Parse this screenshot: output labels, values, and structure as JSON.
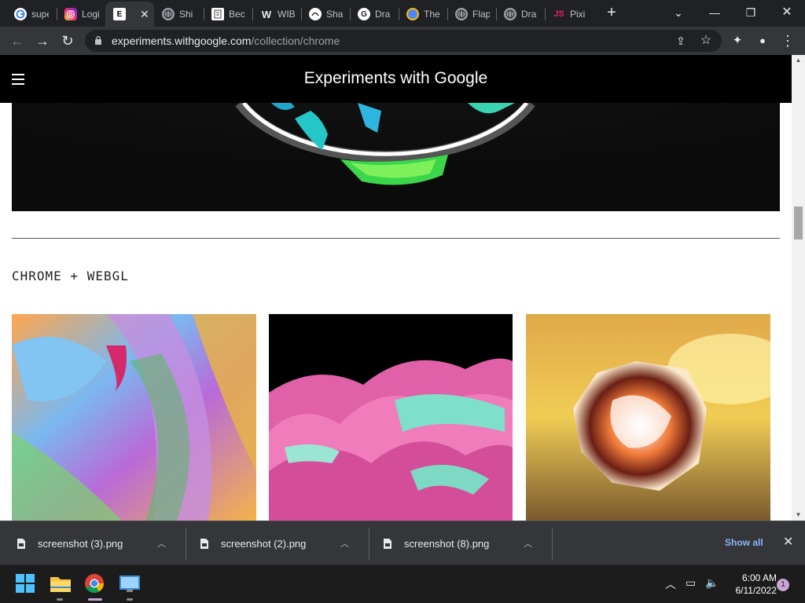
{
  "tabs": [
    {
      "label": "supe",
      "icon": "google-icon",
      "color": "#ffffff"
    },
    {
      "label": "Logi",
      "icon": "instagram-icon",
      "color": "#e1306c"
    },
    {
      "label": "",
      "icon": "experiments-icon",
      "color": "#ffffff",
      "active": true
    },
    {
      "label": "Shi",
      "icon": "globe-icon",
      "color": "#9aa0a6"
    },
    {
      "label": "Bec",
      "icon": "doc-icon",
      "color": "#ffffff"
    },
    {
      "label": "WIB",
      "icon": "w-icon",
      "color": "#ffffff"
    },
    {
      "label": "Sha",
      "icon": "shader-icon",
      "color": "#ffffff"
    },
    {
      "label": "Dra",
      "icon": "github-icon",
      "color": "#ffffff"
    },
    {
      "label": "The",
      "icon": "chrome-logo-icon",
      "color": "#4f86f7"
    },
    {
      "label": "Flap",
      "icon": "globe-icon",
      "color": "#9aa0a6"
    },
    {
      "label": "Dra",
      "icon": "globe-icon",
      "color": "#9aa0a6"
    },
    {
      "label": "Pixi",
      "icon": "js-icon",
      "color": "#e91e63"
    }
  ],
  "active_tab_letter": "E",
  "active_tab_close": "✕",
  "github_letter": "G",
  "js_letter": "JS",
  "w_letter": "W",
  "new_tab": "+",
  "window": {
    "tab_search": "⌄",
    "minimize": "—",
    "restore": "❐",
    "close": "✕"
  },
  "toolbar": {
    "back": "←",
    "forward": "→",
    "reload": "↻",
    "url_host": "experiments.withgoogle.com",
    "url_path": "/collection/chrome",
    "share": "⇪",
    "bookmark": "☆",
    "extensions": "✦",
    "profile": "●",
    "menu": "⋮"
  },
  "site": {
    "title": "Experiments with Google",
    "section_title": "CHROME + WEBGL"
  },
  "scrollbar": {
    "up": "▲",
    "down": "▼"
  },
  "downloads": {
    "items": [
      {
        "name": "screenshot (3).png",
        "caret": "︿"
      },
      {
        "name": "screenshot (2).png",
        "caret": "︿"
      },
      {
        "name": "screenshot (8).png",
        "caret": "︿"
      }
    ],
    "show_all": "Show all",
    "close": "✕"
  },
  "taskbar": {
    "tray_chevron": "︿",
    "network": "▭",
    "volume": "🔈",
    "time": "6:00 AM",
    "date": "6/11/2022",
    "notifications": "1"
  }
}
